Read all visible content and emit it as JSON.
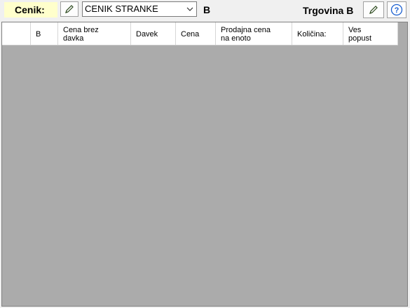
{
  "toolbar": {
    "cenik_label": "Cenik:",
    "cenik_edit_icon": "pencil-icon",
    "cenik_select_value": "CENIK STRANKE",
    "cenik_code": "B",
    "store_label": "Trgovina B",
    "store_edit_icon": "pencil-icon",
    "help_icon": "help-icon"
  },
  "grid": {
    "columns": [
      "",
      "B",
      "Cena brez\ndavka",
      "Davek",
      "Cena",
      "Prodajna cena\nna enoto",
      "Količina:",
      "Ves\npopust"
    ],
    "rows": []
  },
  "colors": {
    "label_highlight": "#ffffcc",
    "grid_background": "#ababab",
    "help_blue": "#1a5fd0"
  }
}
